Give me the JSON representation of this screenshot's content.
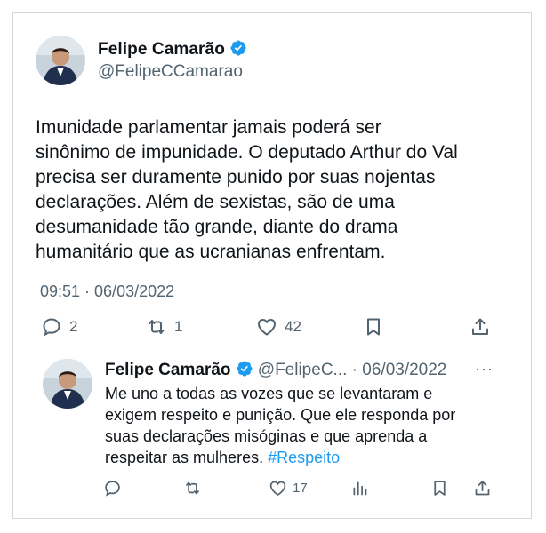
{
  "main_tweet": {
    "author_name": "Felipe Camarão",
    "handle": "@FelipeCCamarao",
    "verified_icon": "verified-badge-icon",
    "text_lines": [
      "Imunidade parlamentar jamais poderá ser",
      "sinônimo de impunidade. O deputado Arthur do Val",
      "precisa ser duramente punido por suas nojentas",
      "declarações. Além de sexistas, são de uma",
      "desumanidade tão grande, diante do drama",
      "humanitário que as ucranianas enfrentam."
    ],
    "timestamp": "09:51 · 06/03/2022",
    "reply_count": "2",
    "retweet_count": "1",
    "like_count": "42"
  },
  "reply_tweet": {
    "author_name": "Felipe Camarão",
    "handle": "@FelipeC...",
    "separator": " · ",
    "date": "06/03/2022",
    "more": "···",
    "text_lines": [
      "Me uno a todas as vozes que se levantaram e",
      "exigem respeito e punição. Que ele responda por",
      "suas declarações misóginas e que aprenda a"
    ],
    "last_line_text": "respeitar as mulheres. ",
    "hashtag": "#Respeito",
    "like_count": "17"
  },
  "colors": {
    "text": "#0f1419",
    "secondary": "#536471",
    "link": "#1d9bf0",
    "verified": "#1d9bf0",
    "border": "#cfd9de"
  }
}
